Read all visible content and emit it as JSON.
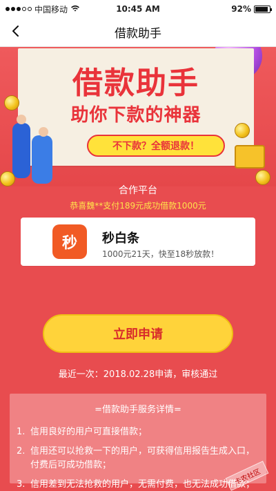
{
  "status_bar": {
    "carrier": "中国移动",
    "time": "10:45 AM",
    "battery_percent": "92%",
    "battery_level": 0.92
  },
  "nav": {
    "title": "借款助手",
    "back_icon": "chevron-left-icon"
  },
  "hero": {
    "title": "借款助手",
    "subtitle": "助你下款的神器",
    "pill": "不下款？全额退款！",
    "colors": {
      "background": "#e84c4f",
      "banner": "#f6efe2",
      "accent": "#e9333a",
      "pill": "#ffe23a"
    }
  },
  "partner": {
    "label": "合作平台",
    "congrats": "恭喜魏**支付189元成功借款1000元",
    "loan": {
      "name": "秒白条",
      "desc": "1000元21天，快至18秒放款！",
      "icon_text": "秒"
    }
  },
  "cta": {
    "apply_label": "立即申请",
    "last_apply": "最近一次：2018.02.28申请，审核通过"
  },
  "service": {
    "title": "=借款助手服务详情=",
    "items": [
      {
        "num": "1.",
        "text": "信用良好的用户可直接借款；"
      },
      {
        "num": "2.",
        "text": "信用还可以抢救一下的用户，可获得信用报告生成入口，付费后可成功借款；"
      },
      {
        "num": "3.",
        "text": "信用差到无法抢救的用户，无需付费，也无法成功借款；"
      }
    ]
  },
  "watermark": {
    "text": "卡农社区"
  }
}
